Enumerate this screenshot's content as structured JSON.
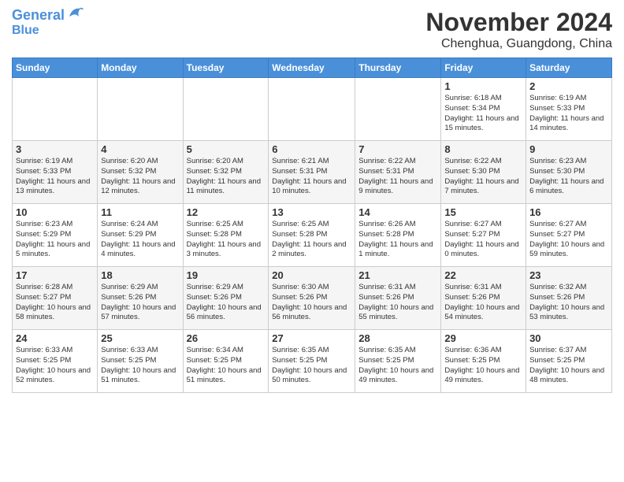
{
  "header": {
    "logo_line1": "General",
    "logo_line2": "Blue",
    "month_title": "November 2024",
    "subtitle": "Chenghua, Guangdong, China"
  },
  "weekdays": [
    "Sunday",
    "Monday",
    "Tuesday",
    "Wednesday",
    "Thursday",
    "Friday",
    "Saturday"
  ],
  "weeks": [
    [
      {
        "day": "",
        "info": ""
      },
      {
        "day": "",
        "info": ""
      },
      {
        "day": "",
        "info": ""
      },
      {
        "day": "",
        "info": ""
      },
      {
        "day": "",
        "info": ""
      },
      {
        "day": "1",
        "info": "Sunrise: 6:18 AM\nSunset: 5:34 PM\nDaylight: 11 hours and 15 minutes."
      },
      {
        "day": "2",
        "info": "Sunrise: 6:19 AM\nSunset: 5:33 PM\nDaylight: 11 hours and 14 minutes."
      }
    ],
    [
      {
        "day": "3",
        "info": "Sunrise: 6:19 AM\nSunset: 5:33 PM\nDaylight: 11 hours and 13 minutes."
      },
      {
        "day": "4",
        "info": "Sunrise: 6:20 AM\nSunset: 5:32 PM\nDaylight: 11 hours and 12 minutes."
      },
      {
        "day": "5",
        "info": "Sunrise: 6:20 AM\nSunset: 5:32 PM\nDaylight: 11 hours and 11 minutes."
      },
      {
        "day": "6",
        "info": "Sunrise: 6:21 AM\nSunset: 5:31 PM\nDaylight: 11 hours and 10 minutes."
      },
      {
        "day": "7",
        "info": "Sunrise: 6:22 AM\nSunset: 5:31 PM\nDaylight: 11 hours and 9 minutes."
      },
      {
        "day": "8",
        "info": "Sunrise: 6:22 AM\nSunset: 5:30 PM\nDaylight: 11 hours and 7 minutes."
      },
      {
        "day": "9",
        "info": "Sunrise: 6:23 AM\nSunset: 5:30 PM\nDaylight: 11 hours and 6 minutes."
      }
    ],
    [
      {
        "day": "10",
        "info": "Sunrise: 6:23 AM\nSunset: 5:29 PM\nDaylight: 11 hours and 5 minutes."
      },
      {
        "day": "11",
        "info": "Sunrise: 6:24 AM\nSunset: 5:29 PM\nDaylight: 11 hours and 4 minutes."
      },
      {
        "day": "12",
        "info": "Sunrise: 6:25 AM\nSunset: 5:28 PM\nDaylight: 11 hours and 3 minutes."
      },
      {
        "day": "13",
        "info": "Sunrise: 6:25 AM\nSunset: 5:28 PM\nDaylight: 11 hours and 2 minutes."
      },
      {
        "day": "14",
        "info": "Sunrise: 6:26 AM\nSunset: 5:28 PM\nDaylight: 11 hours and 1 minute."
      },
      {
        "day": "15",
        "info": "Sunrise: 6:27 AM\nSunset: 5:27 PM\nDaylight: 11 hours and 0 minutes."
      },
      {
        "day": "16",
        "info": "Sunrise: 6:27 AM\nSunset: 5:27 PM\nDaylight: 10 hours and 59 minutes."
      }
    ],
    [
      {
        "day": "17",
        "info": "Sunrise: 6:28 AM\nSunset: 5:27 PM\nDaylight: 10 hours and 58 minutes."
      },
      {
        "day": "18",
        "info": "Sunrise: 6:29 AM\nSunset: 5:26 PM\nDaylight: 10 hours and 57 minutes."
      },
      {
        "day": "19",
        "info": "Sunrise: 6:29 AM\nSunset: 5:26 PM\nDaylight: 10 hours and 56 minutes."
      },
      {
        "day": "20",
        "info": "Sunrise: 6:30 AM\nSunset: 5:26 PM\nDaylight: 10 hours and 56 minutes."
      },
      {
        "day": "21",
        "info": "Sunrise: 6:31 AM\nSunset: 5:26 PM\nDaylight: 10 hours and 55 minutes."
      },
      {
        "day": "22",
        "info": "Sunrise: 6:31 AM\nSunset: 5:26 PM\nDaylight: 10 hours and 54 minutes."
      },
      {
        "day": "23",
        "info": "Sunrise: 6:32 AM\nSunset: 5:26 PM\nDaylight: 10 hours and 53 minutes."
      }
    ],
    [
      {
        "day": "24",
        "info": "Sunrise: 6:33 AM\nSunset: 5:25 PM\nDaylight: 10 hours and 52 minutes."
      },
      {
        "day": "25",
        "info": "Sunrise: 6:33 AM\nSunset: 5:25 PM\nDaylight: 10 hours and 51 minutes."
      },
      {
        "day": "26",
        "info": "Sunrise: 6:34 AM\nSunset: 5:25 PM\nDaylight: 10 hours and 51 minutes."
      },
      {
        "day": "27",
        "info": "Sunrise: 6:35 AM\nSunset: 5:25 PM\nDaylight: 10 hours and 50 minutes."
      },
      {
        "day": "28",
        "info": "Sunrise: 6:35 AM\nSunset: 5:25 PM\nDaylight: 10 hours and 49 minutes."
      },
      {
        "day": "29",
        "info": "Sunrise: 6:36 AM\nSunset: 5:25 PM\nDaylight: 10 hours and 49 minutes."
      },
      {
        "day": "30",
        "info": "Sunrise: 6:37 AM\nSunset: 5:25 PM\nDaylight: 10 hours and 48 minutes."
      }
    ]
  ]
}
